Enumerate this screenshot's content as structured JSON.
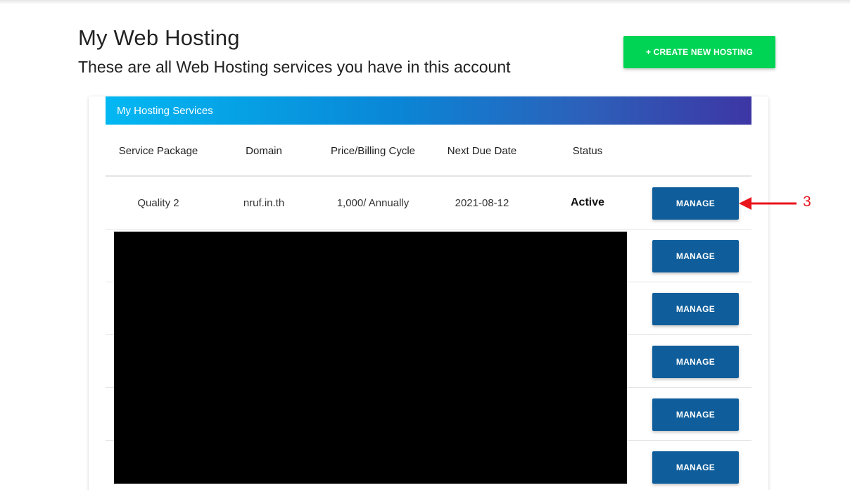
{
  "header": {
    "title": "My Web Hosting",
    "subtitle": "These are all Web Hosting services you have in this account",
    "create_button_label": "+ CREATE NEW HOSTING"
  },
  "services_card": {
    "title": "My Hosting Services",
    "columns": [
      "Service Package",
      "Domain",
      "Price/Billing Cycle",
      "Next Due Date",
      "Status"
    ],
    "rows": [
      {
        "package": "Quality 2",
        "domain": "nruf.in.th",
        "price_cycle": "1,000/ Annually",
        "next_due": "2021-08-12",
        "status": "Active",
        "action_label": "MANAGE"
      },
      {
        "action_label": "MANAGE"
      },
      {
        "action_label": "MANAGE"
      },
      {
        "action_label": "MANAGE"
      },
      {
        "action_label": "MANAGE"
      },
      {
        "action_label": "MANAGE"
      }
    ]
  },
  "annotation": {
    "number": "3",
    "color": "#e8141b"
  },
  "colors": {
    "create_button": "#00d455",
    "manage_button": "#0f5e9b",
    "header_gradient_start": "#03b8f2",
    "header_gradient_end": "#3d36a4"
  }
}
